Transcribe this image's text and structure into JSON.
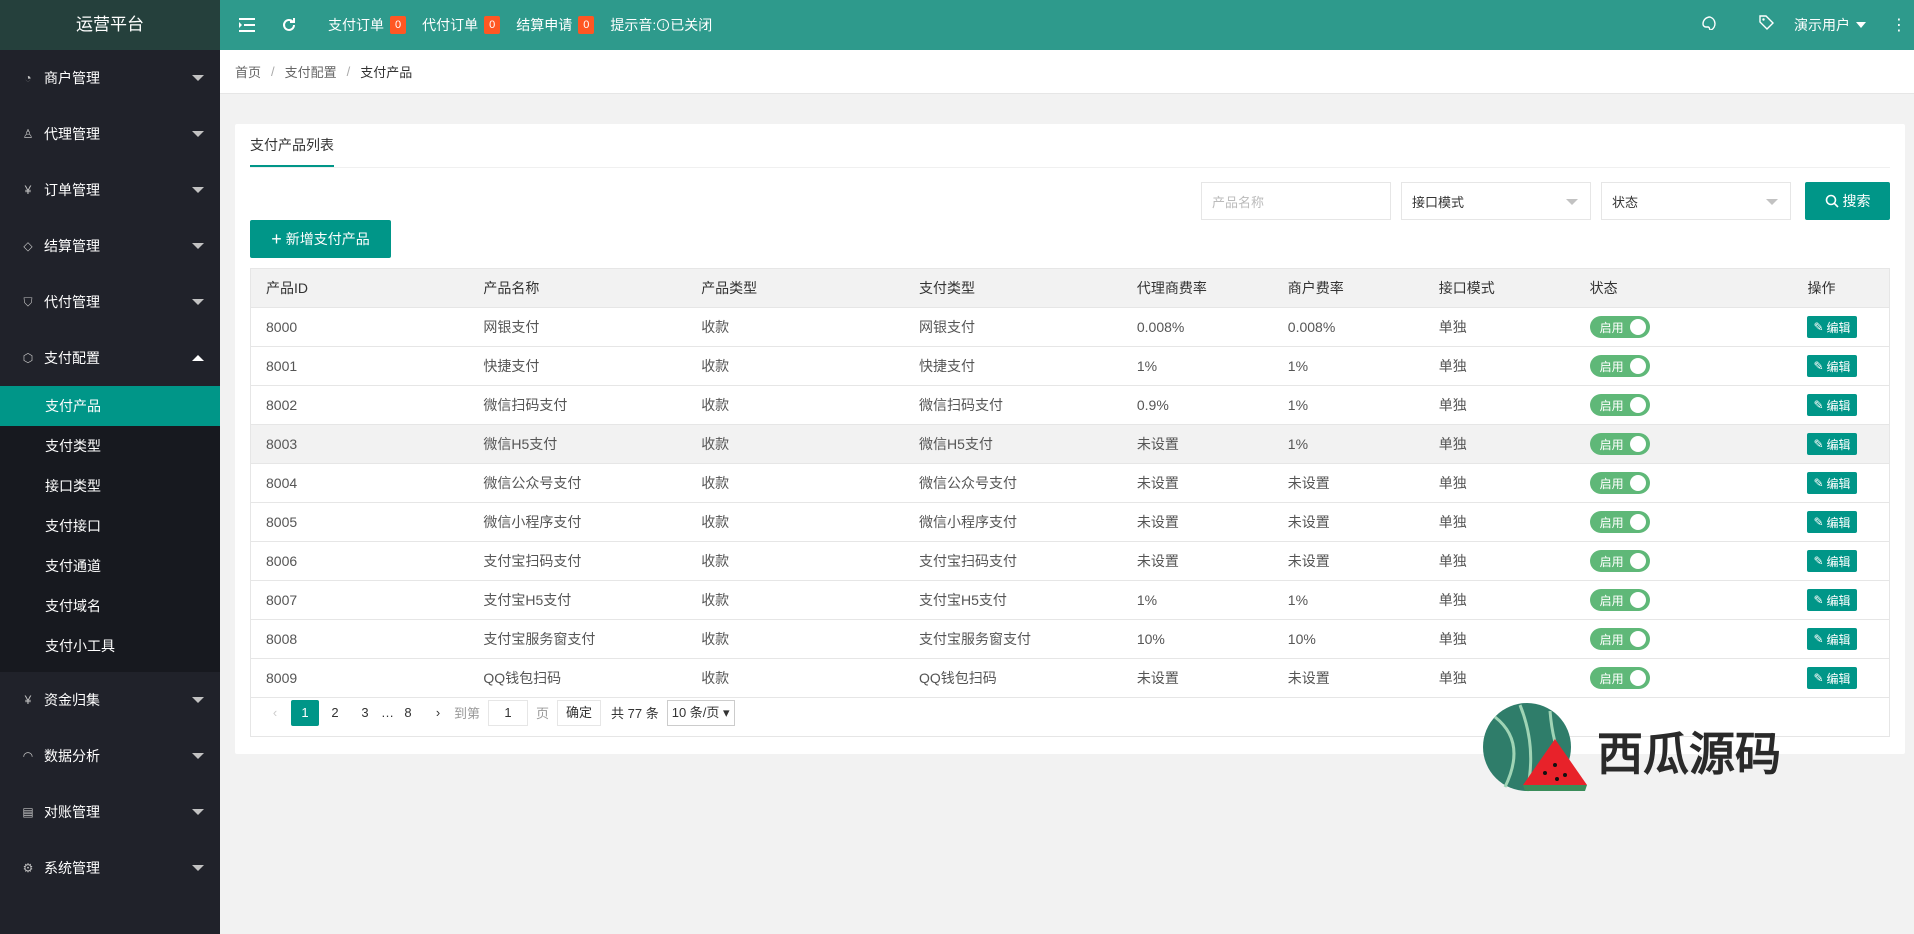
{
  "app": {
    "title": "运营平台"
  },
  "sidebar": {
    "groups_top": [
      {
        "label": "商户管理",
        "icon": "user-circle-icon"
      },
      {
        "label": "代理管理",
        "icon": "user-icon"
      },
      {
        "label": "订单管理",
        "icon": "yen-icon"
      },
      {
        "label": "结算管理",
        "icon": "diamond-icon"
      },
      {
        "label": "代付管理",
        "icon": "shield-icon"
      },
      {
        "label": "支付配置",
        "icon": "cube-icon"
      }
    ],
    "sub_items": [
      "支付产品",
      "支付类型",
      "接口类型",
      "支付接口",
      "支付通道",
      "支付域名",
      "支付小工具"
    ],
    "groups_bottom": [
      {
        "label": "资金归集",
        "icon": "yen-icon"
      },
      {
        "label": "数据分析",
        "icon": "gauge-icon"
      },
      {
        "label": "对账管理",
        "icon": "document-check-icon"
      },
      {
        "label": "系统管理",
        "icon": "gear-icon"
      }
    ]
  },
  "topbar": {
    "pay_orders": "支付订单",
    "pay_orders_count": "0",
    "proxy_orders": "代付订单",
    "proxy_orders_count": "0",
    "settle_apply": "结算申请",
    "settle_apply_count": "0",
    "sound_label": "提示音:",
    "sound_state": "已关闭",
    "user": "演示用户"
  },
  "breadcrumb": {
    "home": "首页",
    "level1": "支付配置",
    "current": "支付产品"
  },
  "card": {
    "tab": "支付产品列表",
    "add_button": "新增支付产品"
  },
  "filters": {
    "name_placeholder": "产品名称",
    "mode_select": "接口模式",
    "status_select": "状态",
    "search_button": "搜索"
  },
  "table": {
    "headers": [
      "产品ID",
      "产品名称",
      "产品类型",
      "支付类型",
      "代理商费率",
      "商户费率",
      "接口模式",
      "状态",
      "操作"
    ],
    "rows": [
      {
        "id": "8000",
        "name": "网银支付",
        "ptype": "收款",
        "paytype": "网银支付",
        "agent": "0.008%",
        "merchant": "0.008%",
        "mode": "单独",
        "status": "启用",
        "action": "编辑"
      },
      {
        "id": "8001",
        "name": "快捷支付",
        "ptype": "收款",
        "paytype": "快捷支付",
        "agent": "1%",
        "merchant": "1%",
        "mode": "单独",
        "status": "启用",
        "action": "编辑"
      },
      {
        "id": "8002",
        "name": "微信扫码支付",
        "ptype": "收款",
        "paytype": "微信扫码支付",
        "agent": "0.9%",
        "merchant": "1%",
        "mode": "单独",
        "status": "启用",
        "action": "编辑"
      },
      {
        "id": "8003",
        "name": "微信H5支付",
        "ptype": "收款",
        "paytype": "微信H5支付",
        "agent": "未设置",
        "merchant": "1%",
        "mode": "单独",
        "status": "启用",
        "action": "编辑"
      },
      {
        "id": "8004",
        "name": "微信公众号支付",
        "ptype": "收款",
        "paytype": "微信公众号支付",
        "agent": "未设置",
        "merchant": "未设置",
        "mode": "单独",
        "status": "启用",
        "action": "编辑"
      },
      {
        "id": "8005",
        "name": "微信小程序支付",
        "ptype": "收款",
        "paytype": "微信小程序支付",
        "agent": "未设置",
        "merchant": "未设置",
        "mode": "单独",
        "status": "启用",
        "action": "编辑"
      },
      {
        "id": "8006",
        "name": "支付宝扫码支付",
        "ptype": "收款",
        "paytype": "支付宝扫码支付",
        "agent": "未设置",
        "merchant": "未设置",
        "mode": "单独",
        "status": "启用",
        "action": "编辑"
      },
      {
        "id": "8007",
        "name": "支付宝H5支付",
        "ptype": "收款",
        "paytype": "支付宝H5支付",
        "agent": "1%",
        "merchant": "1%",
        "mode": "单独",
        "status": "启用",
        "action": "编辑"
      },
      {
        "id": "8008",
        "name": "支付宝服务窗支付",
        "ptype": "收款",
        "paytype": "支付宝服务窗支付",
        "agent": "10%",
        "merchant": "10%",
        "mode": "单独",
        "status": "启用",
        "action": "编辑"
      },
      {
        "id": "8009",
        "name": "QQ钱包扫码",
        "ptype": "收款",
        "paytype": "QQ钱包扫码",
        "agent": "未设置",
        "merchant": "未设置",
        "mode": "单独",
        "status": "启用",
        "action": "编辑"
      }
    ]
  },
  "pager": {
    "pages": [
      "1",
      "2",
      "3"
    ],
    "ellipsis": "…",
    "last": "8",
    "goto_label": "到第",
    "goto_value": "1",
    "page_unit": "页",
    "confirm": "确定",
    "total": "共 77 条",
    "per_page": "10 条/页"
  },
  "watermark": {
    "text": "西瓜源码"
  }
}
